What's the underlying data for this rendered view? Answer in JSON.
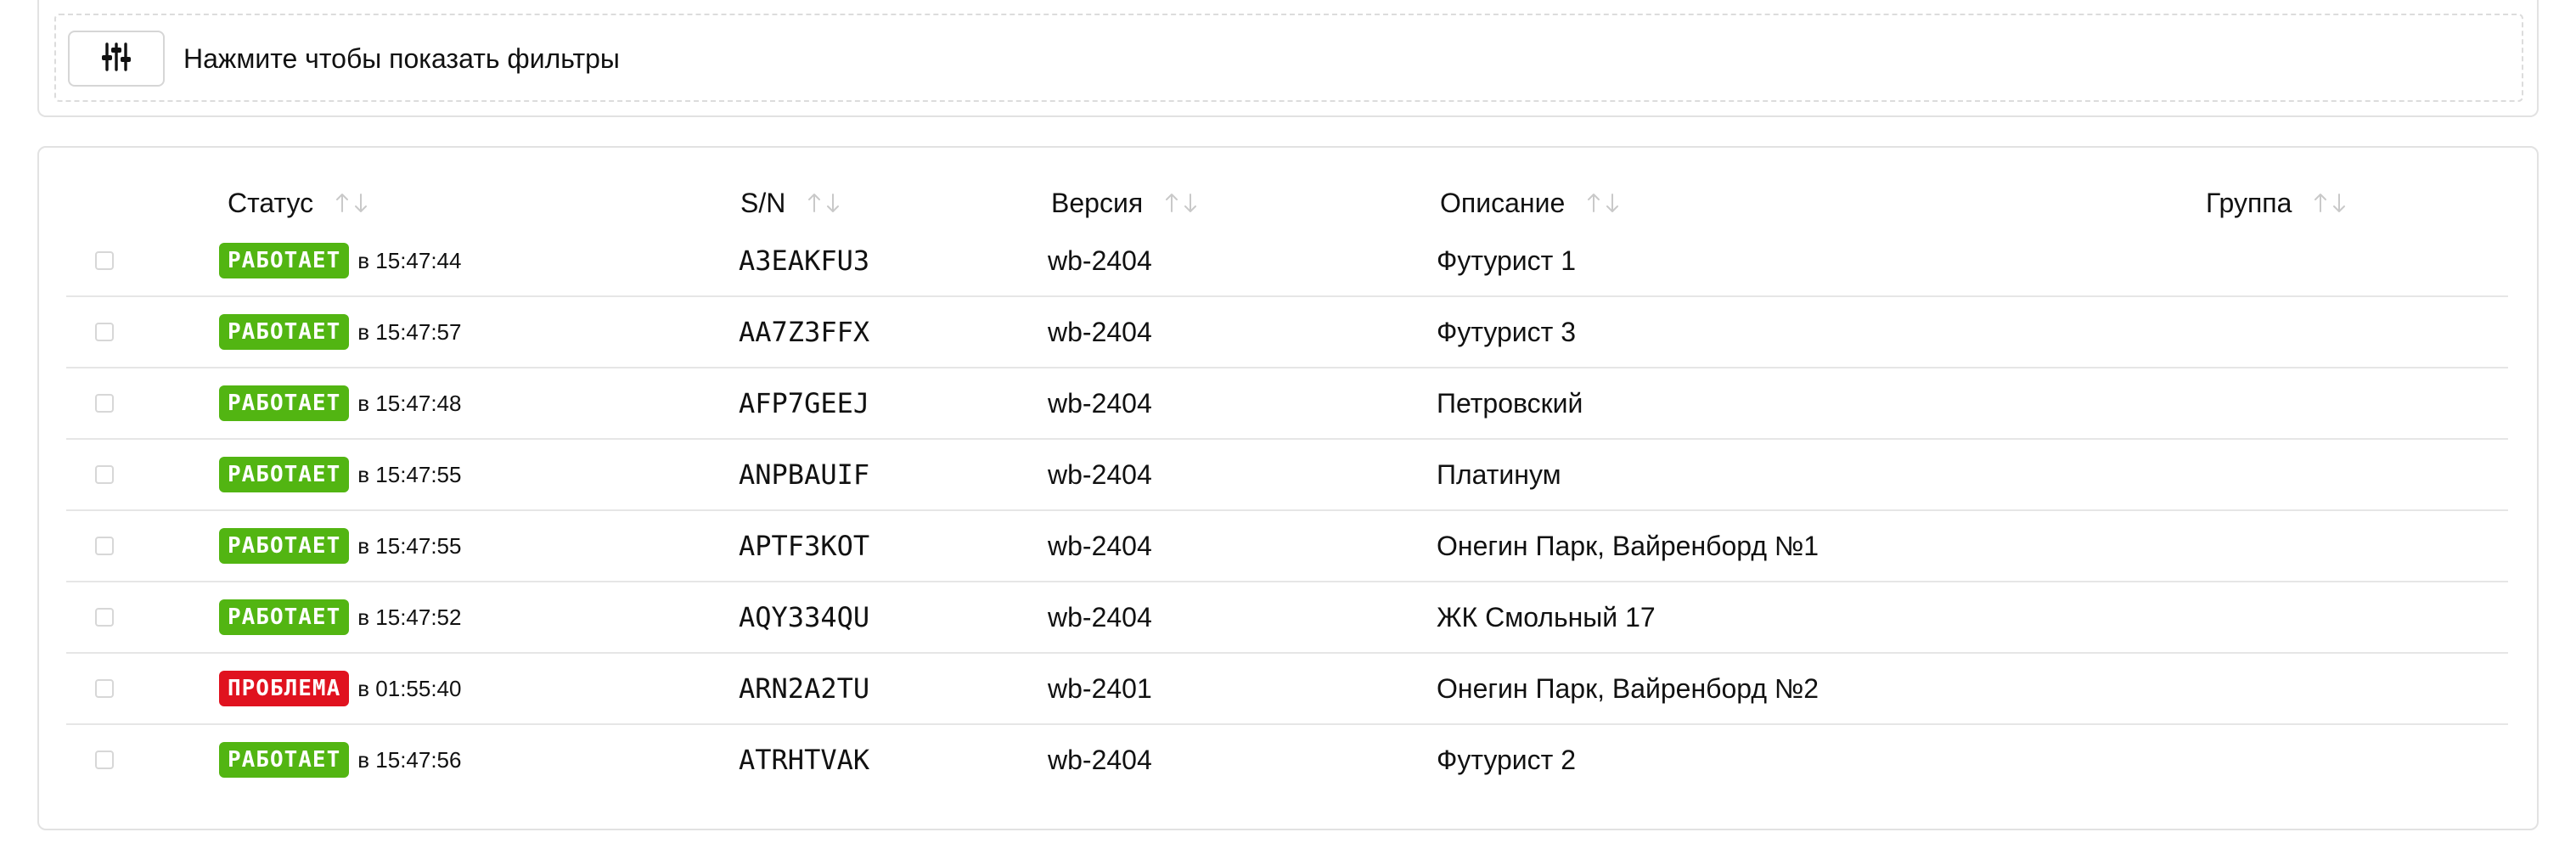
{
  "filters": {
    "label": "Нажмите чтобы показать фильтры",
    "icon": "sliders-icon"
  },
  "table": {
    "columns": [
      {
        "key": "status",
        "label": "Статус"
      },
      {
        "key": "sn",
        "label": "S/N"
      },
      {
        "key": "version",
        "label": "Версия"
      },
      {
        "key": "description",
        "label": "Описание"
      },
      {
        "key": "group",
        "label": "Группа"
      }
    ],
    "rows": [
      {
        "status": "РАБОТАЕТ",
        "status_kind": "ok",
        "time": "в 15:47:44",
        "sn": "A3EAKFU3",
        "version": "wb-2404",
        "description": "Футурист 1",
        "group": ""
      },
      {
        "status": "РАБОТАЕТ",
        "status_kind": "ok",
        "time": "в 15:47:57",
        "sn": "AA7Z3FFX",
        "version": "wb-2404",
        "description": "Футурист 3",
        "group": ""
      },
      {
        "status": "РАБОТАЕТ",
        "status_kind": "ok",
        "time": "в 15:47:48",
        "sn": "AFP7GEEJ",
        "version": "wb-2404",
        "description": "Петровский",
        "group": ""
      },
      {
        "status": "РАБОТАЕТ",
        "status_kind": "ok",
        "time": "в 15:47:55",
        "sn": "ANPBAUIF",
        "version": "wb-2404",
        "description": "Платинум",
        "group": ""
      },
      {
        "status": "РАБОТАЕТ",
        "status_kind": "ok",
        "time": "в 15:47:55",
        "sn": "APTF3KOT",
        "version": "wb-2404",
        "description": "Онегин Парк, Вайренборд №1",
        "group": ""
      },
      {
        "status": "РАБОТАЕТ",
        "status_kind": "ok",
        "time": "в 15:47:52",
        "sn": "AQY334QU",
        "version": "wb-2404",
        "description": "ЖК Смольный 17",
        "group": ""
      },
      {
        "status": "ПРОБЛЕМА",
        "status_kind": "problem",
        "time": "в 01:55:40",
        "sn": "ARN2A2TU",
        "version": "wb-2401",
        "description": "Онегин Парк, Вайренборд №2",
        "group": ""
      },
      {
        "status": "РАБОТАЕТ",
        "status_kind": "ok",
        "time": "в 15:47:56",
        "sn": "ATRHTVAK",
        "version": "wb-2404",
        "description": "Футурист 2",
        "group": ""
      }
    ]
  },
  "colors": {
    "ok": "#52b512",
    "problem": "#e0121f",
    "sort_arrow": "#c9c9c9"
  }
}
